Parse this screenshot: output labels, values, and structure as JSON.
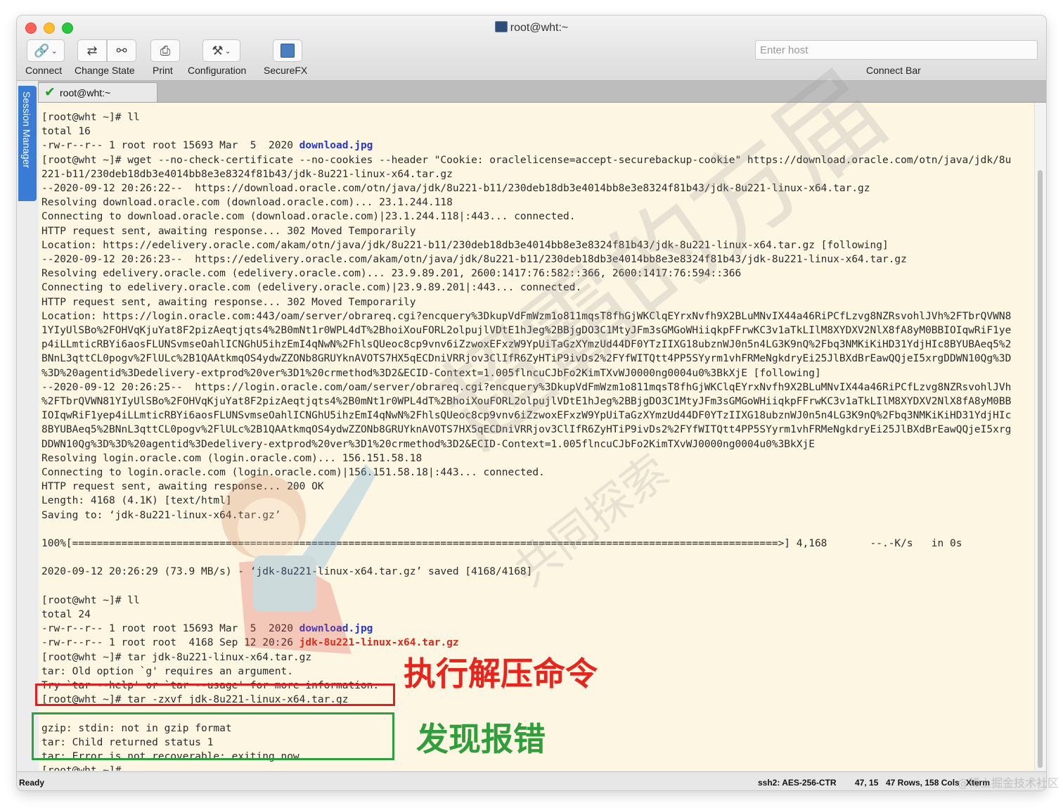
{
  "window": {
    "title": "root@wht:~"
  },
  "toolbar": {
    "connect": "Connect",
    "change_state": "Change State",
    "print": "Print",
    "configuration": "Configuration",
    "securefx": "SecureFX",
    "host_placeholder": "Enter host",
    "connect_bar": "Connect Bar"
  },
  "session_manager": "Session Manager",
  "tab": {
    "label": "root@wht:~"
  },
  "terminal": {
    "lines": [
      {
        "t": "[root@wht ~]# ll"
      },
      {
        "t": "total 16"
      },
      {
        "t": "-rw-r--r-- 1 root root 15693 Mar  5  2020 ",
        "hl": "download.jpg",
        "hlc": "blue"
      },
      {
        "t": "[root@wht ~]# wget --no-check-certificate --no-cookies --header \"Cookie: oraclelicense=accept-securebackup-cookie\" https://download.oracle.com/otn/java/jdk/8u"
      },
      {
        "t": "221-b11/230deb18db3e4014bb8e3e8324f81b43/jdk-8u221-linux-x64.tar.gz"
      },
      {
        "t": "--2020-09-12 20:26:22--  https://download.oracle.com/otn/java/jdk/8u221-b11/230deb18db3e4014bb8e3e8324f81b43/jdk-8u221-linux-x64.tar.gz"
      },
      {
        "t": "Resolving download.oracle.com (download.oracle.com)... 23.1.244.118"
      },
      {
        "t": "Connecting to download.oracle.com (download.oracle.com)|23.1.244.118|:443... connected."
      },
      {
        "t": "HTTP request sent, awaiting response... 302 Moved Temporarily"
      },
      {
        "t": "Location: https://edelivery.oracle.com/akam/otn/java/jdk/8u221-b11/230deb18db3e4014bb8e3e8324f81b43/jdk-8u221-linux-x64.tar.gz [following]"
      },
      {
        "t": "--2020-09-12 20:26:23--  https://edelivery.oracle.com/akam/otn/java/jdk/8u221-b11/230deb18db3e4014bb8e3e8324f81b43/jdk-8u221-linux-x64.tar.gz"
      },
      {
        "t": "Resolving edelivery.oracle.com (edelivery.oracle.com)... 23.9.89.201, 2600:1417:76:582::366, 2600:1417:76:594::366"
      },
      {
        "t": "Connecting to edelivery.oracle.com (edelivery.oracle.com)|23.9.89.201|:443... connected."
      },
      {
        "t": "HTTP request sent, awaiting response... 302 Moved Temporarily"
      },
      {
        "t": "Location: https://login.oracle.com:443/oam/server/obrareq.cgi?encquery%3DkupVdFmWzm1o811mqsT8fhGjWKClqEYrxNvfh9X2BLuMNvIX44a46RiPCfLzvg8NZRsvohlJVh%2FTbrQVWN8"
      },
      {
        "t": "1YIyUlSBo%2FOHVqKjuYat8F2pizAeqtjqts4%2B0mNt1r0WPL4dT%2BhoiXouFORL2olpujlVDtE1hJeg%2BBjgDO3C1MtyJFm3sGMGoWHiiqkpFFrwKC3v1aTkLIlM8XYDXV2NlX8fA8yM0BBIOIqwRiF1ye"
      },
      {
        "t": "p4iLLmticRBYi6aosFLUNSvmseOahlICNGhU5ihzEmI4qNwN%2FhlsQUeoc8cp9vnv6iZzwoxEFxzW9YpUiTaGzXYmzUd44DF0YTzIIXG18ubznWJ0n5n4LG3K9nQ%2Fbq3NMKiKiHD31YdjHIc8BYUBAeq5%2"
      },
      {
        "t": "BNnL3qttCL0pogv%2FlULc%2B1QAAtkmqOS4ydwZZONb8GRUYknAVOTS7HX5qECDniVRRjov3ClIfR6ZyHTiP9ivDs2%2FYfWITQtt4PP5SYyrm1vhFRMeNgkdryEi25JlBXdBrEawQQjeI5xrgDDWN10Qg%3D"
      },
      {
        "t": "%3D%20agentid%3Dedelivery-extprod%20ver%3D1%20crmethod%3D2&ECID-Context=1.005flncuCJbFo2KimTXvWJ0000ng0004u0%3BkXjE [following]"
      },
      {
        "t": "--2020-09-12 20:26:25--  https://login.oracle.com/oam/server/obrareq.cgi?encquery%3DkupVdFmWzm1o811mqsT8fhGjWKClqEYrxNvfh9X2BLuMNvIX44a46RiPCfLzvg8NZRsvohlJVh"
      },
      {
        "t": "%2FTbrQVWN81YIyUlSBo%2FOHVqKjuYat8F2pizAeqtjqts4%2B0mNt1r0WPL4dT%2BhoiXouFORL2olpujlVDtE1hJeg%2BBjgDO3C1MtyJFm3sGMGoWHiiqkpFFrwKC3v1aTkLIlM8XYDXV2NlX8fA8yM0BB"
      },
      {
        "t": "IOIqwRiF1yep4iLLmticRBYi6aosFLUNSvmseOahlICNGhU5ihzEmI4qNwN%2FhlsQUeoc8cp9vnv6iZzwoxEFxzW9YpUiTaGzXYmzUd44DF0YTzIIXG18ubznWJ0n5n4LG3K9nQ%2Fbq3NMKiKiHD31YdjHIc"
      },
      {
        "t": "8BYUBAeq5%2BNnL3qttCL0pogv%2FlULc%2B1QAAtkmqOS4ydwZZONb8GRUYknAVOTS7HX5qECDniVRRjov3ClIfR6ZyHTiP9ivDs2%2FYfWITQtt4PP5SYyrm1vhFRMeNgkdryEi25JlBXdBrEawQQjeI5xrg"
      },
      {
        "t": "DDWN10Qg%3D%3D%20agentid%3Dedelivery-extprod%20ver%3D1%20crmethod%3D2&ECID-Context=1.005flncuCJbFo2KimTXvWJ0000ng0004u0%3BkXjE"
      },
      {
        "t": "Resolving login.oracle.com (login.oracle.com)... 156.151.58.18"
      },
      {
        "t": "Connecting to login.oracle.com (login.oracle.com)|156.151.58.18|:443... connected."
      },
      {
        "t": "HTTP request sent, awaiting response... 200 OK"
      },
      {
        "t": "Length: 4168 (4.1K) [text/html]"
      },
      {
        "t": "Saving to: ‘jdk-8u221-linux-x64.tar.gz’"
      },
      {
        "t": ""
      },
      {
        "t": "100%[===================================================================================================================>] 4,168       --.-K/s   in 0s"
      },
      {
        "t": ""
      },
      {
        "t": "2020-09-12 20:26:29 (73.9 MB/s) - ‘jdk-8u221-linux-x64.tar.gz’ saved [4168/4168]"
      },
      {
        "t": ""
      },
      {
        "t": "[root@wht ~]# ll"
      },
      {
        "t": "total 24"
      },
      {
        "t": "-rw-r--r-- 1 root root 15693 Mar  5  2020 ",
        "hl": "download.jpg",
        "hlc": "blue"
      },
      {
        "t": "-rw-r--r-- 1 root root  4168 Sep 12 20:26 ",
        "hl": "jdk-8u221-linux-x64.tar.gz",
        "hlc": "red"
      },
      {
        "t": "[root@wht ~]# tar jdk-8u221-linux-x64.tar.gz"
      },
      {
        "t": "tar: Old option `g' requires an argument."
      },
      {
        "t": "Try `tar --help' or `tar --usage' for more information."
      },
      {
        "t": "[root@wht ~]# tar -zxvf jdk-8u221-linux-x64.tar.gz"
      },
      {
        "t": ""
      },
      {
        "t": "gzip: stdin: not in gzip format"
      },
      {
        "t": "tar: Child returned status 1"
      },
      {
        "t": "tar: Error is not recoverable: exiting now"
      },
      {
        "t": "[root@wht ~]#"
      }
    ]
  },
  "annotations": {
    "extract_command": "执行解压命令",
    "error_found": "发现报错"
  },
  "watermark": {
    "title": "超霸的方届",
    "subtitle": "共同探索",
    "footer": "@稀土掘金技术社区"
  },
  "status_bar": {
    "ready": "Ready",
    "cipher": "ssh2: AES-256-CTR",
    "cursor": "47, 15",
    "size": "47 Rows, 158 Cols",
    "emulation": "Xterm"
  },
  "colors": {
    "terminal_bg": "#fdf6e3",
    "annotation_red": "#e8251c",
    "annotation_green": "#2f9e3b",
    "dir_blue": "#2638c9",
    "archive_red": "#d52a1a"
  }
}
